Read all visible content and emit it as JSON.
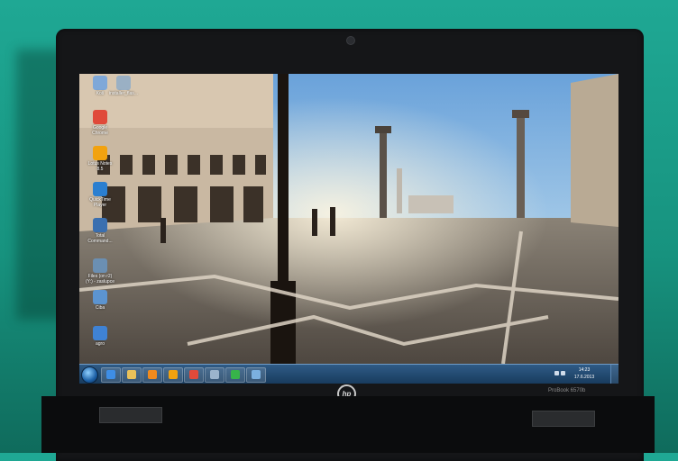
{
  "desktop": {
    "icons": [
      {
        "label": "Koš",
        "icon": "recycle-bin-icon",
        "color": "#7fa8d8"
      },
      {
        "label": "installer_flas...",
        "icon": "installer-icon",
        "color": "#9ab0c4"
      },
      {
        "label": "Google\nChrome",
        "icon": "chrome-icon",
        "color": "#e04a3a"
      },
      {
        "label": "Lotus Notes\n8.5",
        "icon": "lotus-notes-icon",
        "color": "#f2a20f"
      },
      {
        "label": "QuickTime\nPlayer",
        "icon": "quicktime-icon",
        "color": "#2b7fd0"
      },
      {
        "label": "Total\nCommand...",
        "icon": "total-commander-icon",
        "color": "#3a6fb0"
      },
      {
        "label": "Files (on r2)\n(Y:) - zaslupce",
        "icon": "network-drive-icon",
        "color": "#6b8fb2"
      },
      {
        "label": "Ciba",
        "icon": "folder-icon",
        "color": "#5c94d0"
      },
      {
        "label": "agro",
        "icon": "computer-icon",
        "color": "#3f82d4"
      }
    ]
  },
  "taskbar": {
    "start_icon": "windows-orb-icon",
    "pinned": [
      {
        "icon": "internet-explorer-icon",
        "color": "#3e8ee6"
      },
      {
        "icon": "windows-explorer-icon",
        "color": "#e8c15a"
      },
      {
        "icon": "media-player-icon",
        "color": "#f08a1e"
      },
      {
        "icon": "lotus-notes-icon",
        "color": "#f2a20f"
      },
      {
        "icon": "chrome-icon",
        "color": "#e04a3a"
      },
      {
        "icon": "network-icon",
        "color": "#9bb4cc"
      },
      {
        "icon": "spotify-icon",
        "color": "#37b34a"
      },
      {
        "icon": "snipping-tool-icon",
        "color": "#7bb0e0"
      }
    ],
    "clock": {
      "time": "14:23",
      "date": "17.6.2013"
    }
  },
  "laptop": {
    "brand": "hp",
    "model": "ProBook 6570b"
  }
}
